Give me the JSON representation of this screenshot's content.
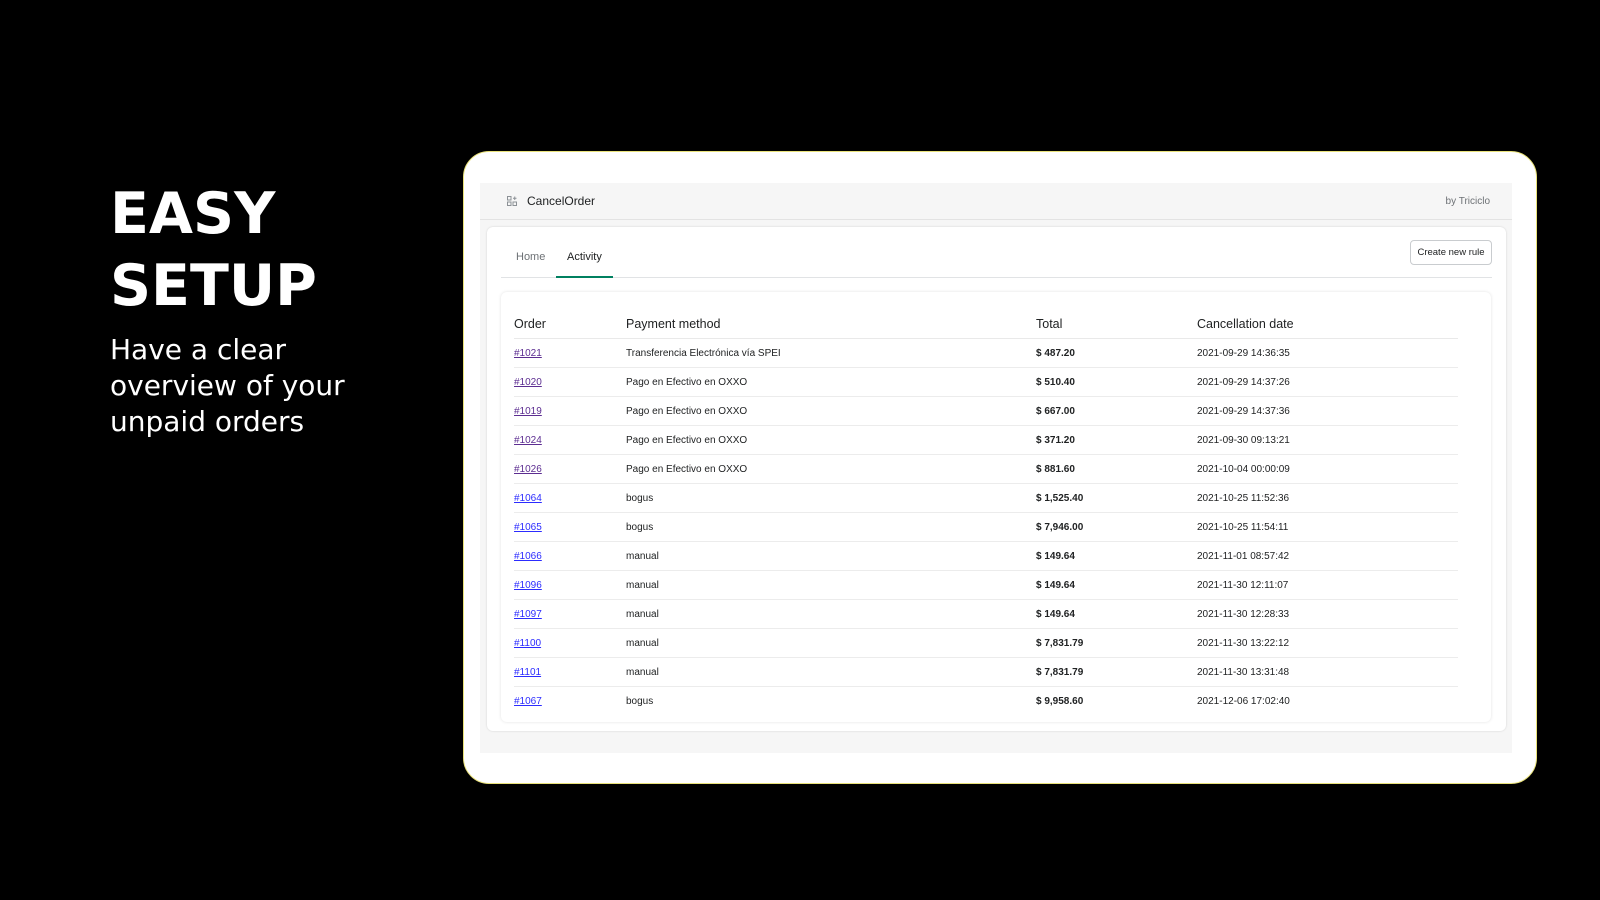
{
  "hero": {
    "title_line1": "EASY",
    "title_line2": "SETUP",
    "subtitle": "Have a clear overview of your unpaid orders"
  },
  "app": {
    "icon": "apps-icon",
    "title": "CancelOrder",
    "by": "by Triciclo"
  },
  "tabs": [
    {
      "label": "Home",
      "active": false
    },
    {
      "label": "Activity",
      "active": true
    }
  ],
  "create_button": "Create new rule",
  "colors": {
    "tab_accent": "#008060",
    "link_visited": "#5c2d91",
    "link": "#2c2cff",
    "frame_border": "#e9e27a"
  },
  "table": {
    "headers": [
      "Order",
      "Payment method",
      "Total",
      "Cancellation date"
    ],
    "rows": [
      {
        "order": "#1021",
        "method": "Transferencia Electrónica vía SPEI",
        "total": "$ 487.20",
        "date": "2021-09-29 14:36:35",
        "visited": true
      },
      {
        "order": "#1020",
        "method": "Pago en Efectivo en OXXO",
        "total": "$ 510.40",
        "date": "2021-09-29 14:37:26",
        "visited": true
      },
      {
        "order": "#1019",
        "method": "Pago en Efectivo en OXXO",
        "total": "$ 667.00",
        "date": "2021-09-29 14:37:36",
        "visited": true
      },
      {
        "order": "#1024",
        "method": "Pago en Efectivo en OXXO",
        "total": "$ 371.20",
        "date": "2021-09-30 09:13:21",
        "visited": true
      },
      {
        "order": "#1026",
        "method": "Pago en Efectivo en OXXO",
        "total": "$ 881.60",
        "date": "2021-10-04 00:00:09",
        "visited": true
      },
      {
        "order": "#1064",
        "method": "bogus",
        "total": "$ 1,525.40",
        "date": "2021-10-25 11:52:36",
        "visited": false
      },
      {
        "order": "#1065",
        "method": "bogus",
        "total": "$ 7,946.00",
        "date": "2021-10-25 11:54:11",
        "visited": false
      },
      {
        "order": "#1066",
        "method": "manual",
        "total": "$ 149.64",
        "date": "2021-11-01 08:57:42",
        "visited": false
      },
      {
        "order": "#1096",
        "method": "manual",
        "total": "$ 149.64",
        "date": "2021-11-30 12:11:07",
        "visited": false
      },
      {
        "order": "#1097",
        "method": "manual",
        "total": "$ 149.64",
        "date": "2021-11-30 12:28:33",
        "visited": false
      },
      {
        "order": "#1100",
        "method": "manual",
        "total": "$ 7,831.79",
        "date": "2021-11-30 13:22:12",
        "visited": false
      },
      {
        "order": "#1101",
        "method": "manual",
        "total": "$ 7,831.79",
        "date": "2021-11-30 13:31:48",
        "visited": false
      },
      {
        "order": "#1067",
        "method": "bogus",
        "total": "$ 9,958.60",
        "date": "2021-12-06 17:02:40",
        "visited": false
      }
    ]
  }
}
